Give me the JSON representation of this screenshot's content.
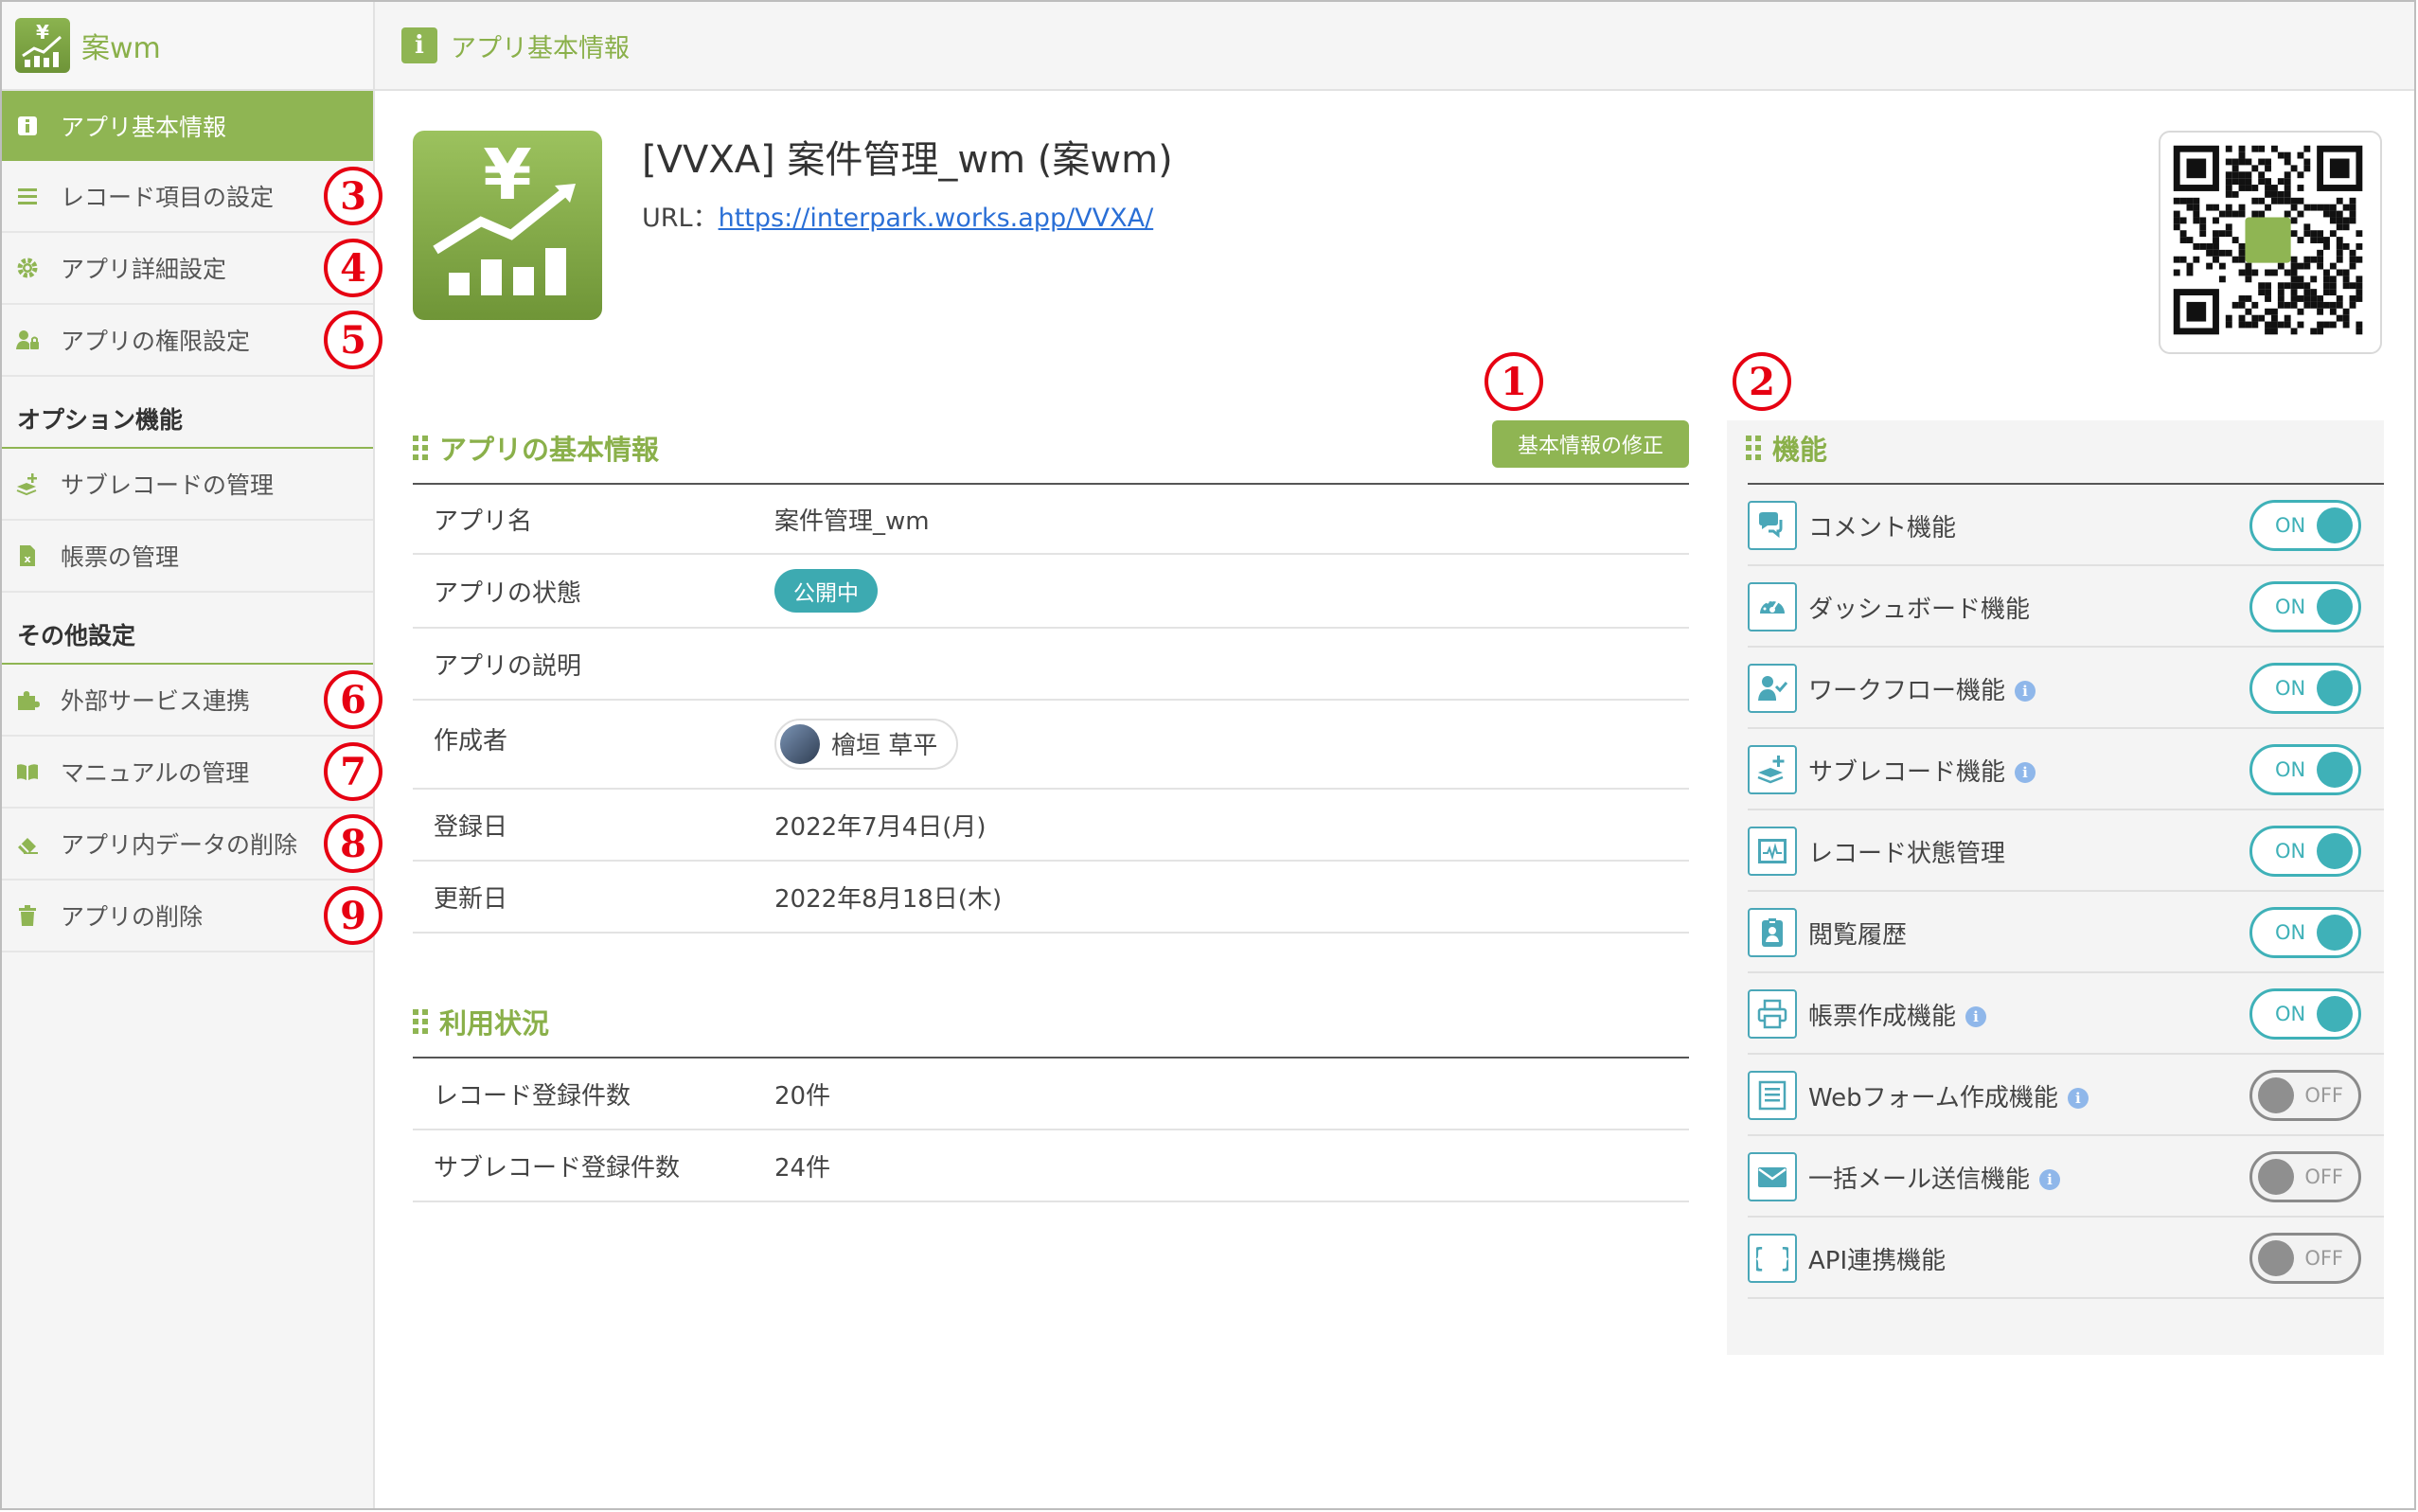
{
  "brand": {
    "name": "案wm"
  },
  "sidebar": {
    "items": [
      {
        "label": "アプリ基本情報",
        "active": true,
        "icon": "info-icon",
        "marker": ""
      },
      {
        "label": "レコード項目の設定",
        "active": false,
        "icon": "list-icon",
        "marker": "3"
      },
      {
        "label": "アプリ詳細設定",
        "active": false,
        "icon": "gear-icon",
        "marker": "4"
      },
      {
        "label": "アプリの権限設定",
        "active": false,
        "icon": "user-lock-icon",
        "marker": "5"
      }
    ],
    "option_section": {
      "title": "オプション機能",
      "items": [
        {
          "label": "サブレコードの管理",
          "icon": "layers-plus-icon"
        },
        {
          "label": "帳票の管理",
          "icon": "excel-file-icon"
        }
      ]
    },
    "other_section": {
      "title": "その他設定",
      "items": [
        {
          "label": "外部サービス連携",
          "icon": "puzzle-icon",
          "marker": "6"
        },
        {
          "label": "マニュアルの管理",
          "icon": "book-icon",
          "marker": "7"
        },
        {
          "label": "アプリ内データの削除",
          "icon": "eraser-icon",
          "marker": "8"
        },
        {
          "label": "アプリの削除",
          "icon": "trash-icon",
          "marker": "9"
        }
      ]
    }
  },
  "header": {
    "title": "アプリ基本情報"
  },
  "app": {
    "title": "[VVXA] 案件管理_wm (案wm)",
    "url_label": "URL：",
    "url": "https://interpark.works.app/VVXA/"
  },
  "markers": {
    "edit": "1",
    "features": "2"
  },
  "basic_info": {
    "title": "アプリの基本情報",
    "edit_button": "基本情報の修正",
    "rows": [
      {
        "key": "アプリ名",
        "value": "案件管理_wm"
      },
      {
        "key": "アプリの状態",
        "value": "公開中"
      },
      {
        "key": "アプリの説明",
        "value": ""
      },
      {
        "key": "作成者",
        "value": "檜垣 草平"
      },
      {
        "key": "登録日",
        "value": "2022年7月4日(月)"
      },
      {
        "key": "更新日",
        "value": "2022年8月18日(木)"
      }
    ]
  },
  "usage": {
    "title": "利用状況",
    "rows": [
      {
        "key": "レコード登録件数",
        "value": "20件"
      },
      {
        "key": "サブレコード登録件数",
        "value": "24件"
      }
    ]
  },
  "features": {
    "title": "機能",
    "items": [
      {
        "label": "コメント機能",
        "state": "ON",
        "info": false,
        "icon": "comments-icon"
      },
      {
        "label": "ダッシュボード機能",
        "state": "ON",
        "info": false,
        "icon": "dashboard-gauge-icon"
      },
      {
        "label": "ワークフロー機能",
        "state": "ON",
        "info": true,
        "icon": "user-check-icon"
      },
      {
        "label": "サブレコード機能",
        "state": "ON",
        "info": true,
        "icon": "layers-plus-icon"
      },
      {
        "label": "レコード状態管理",
        "state": "ON",
        "info": false,
        "icon": "monitor-chart-icon"
      },
      {
        "label": "閲覧履歴",
        "state": "ON",
        "info": false,
        "icon": "id-badge-icon"
      },
      {
        "label": "帳票作成機能",
        "state": "ON",
        "info": true,
        "icon": "printer-icon"
      },
      {
        "label": "Webフォーム作成機能",
        "state": "OFF",
        "info": true,
        "icon": "form-list-icon"
      },
      {
        "label": "一括メール送信機能",
        "state": "OFF",
        "info": true,
        "icon": "envelope-icon"
      },
      {
        "label": "API連携機能",
        "state": "OFF",
        "info": false,
        "icon": "braces-icon"
      }
    ]
  },
  "colors": {
    "accent": "#8fb553",
    "teal": "#3fb1b8",
    "marker_red": "#e60012"
  }
}
